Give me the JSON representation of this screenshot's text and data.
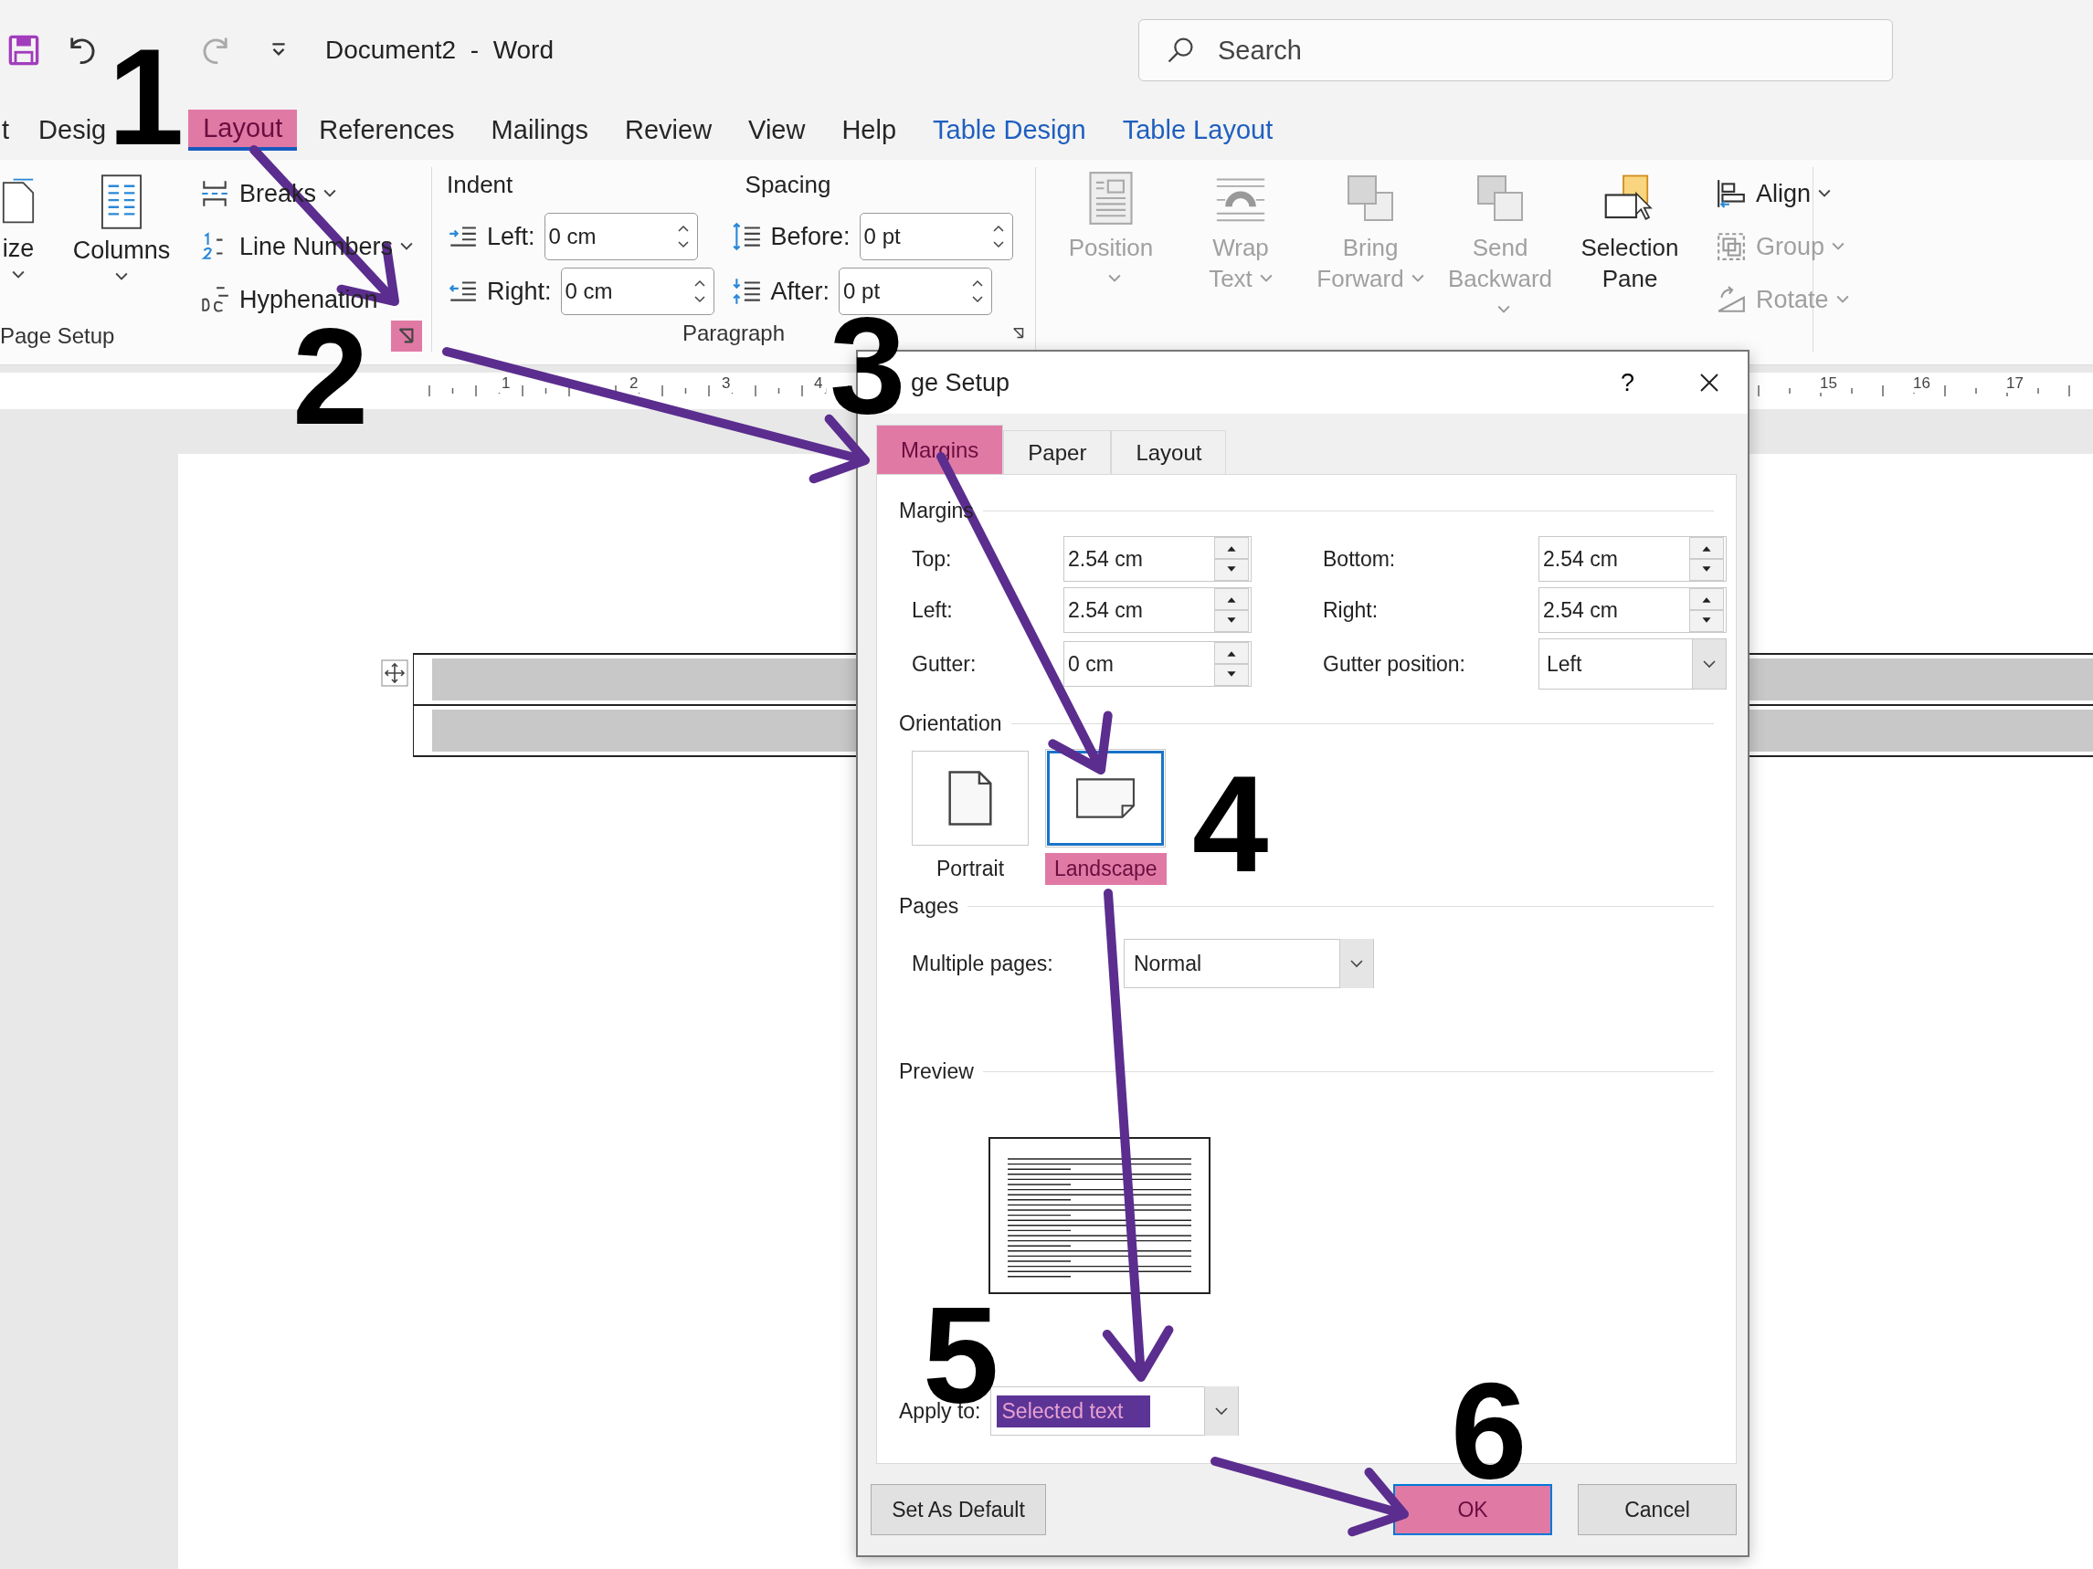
{
  "title_bar": {
    "title": "Document2  -  Word",
    "search": {
      "placeholder": "Search"
    }
  },
  "ribbon_tabs": [
    {
      "label": "t",
      "selected": false,
      "contextual": false,
      "highlighted": false
    },
    {
      "label": "Desig",
      "selected": false,
      "contextual": false,
      "highlighted": false
    },
    {
      "label": "Layout",
      "selected": true,
      "contextual": false,
      "highlighted": true
    },
    {
      "label": "References",
      "selected": false,
      "contextual": false,
      "highlighted": false
    },
    {
      "label": "Mailings",
      "selected": false,
      "contextual": false,
      "highlighted": false
    },
    {
      "label": "Review",
      "selected": false,
      "contextual": false,
      "highlighted": false
    },
    {
      "label": "View",
      "selected": false,
      "contextual": false,
      "highlighted": false
    },
    {
      "label": "Help",
      "selected": false,
      "contextual": false,
      "highlighted": false
    },
    {
      "label": "Table Design",
      "selected": false,
      "contextual": true,
      "highlighted": false
    },
    {
      "label": "Table Layout",
      "selected": false,
      "contextual": true,
      "highlighted": false
    }
  ],
  "ribbon": {
    "page_setup": {
      "size_label": "ize",
      "columns_label": "Columns",
      "commands": [
        {
          "label": "Breaks",
          "kind": "breaks"
        },
        {
          "label": "Line Numbers",
          "kind": "line-numbers"
        },
        {
          "label": "Hyphenation",
          "kind": "hyphenation"
        }
      ],
      "group_label": "Page Setup",
      "launcher_highlighted": true
    },
    "paragraph": {
      "indent_label": "Indent",
      "spacing_label": "Spacing",
      "indent": [
        {
          "label": "Left:",
          "value": "0 cm",
          "kind": "indent-left"
        },
        {
          "label": "Right:",
          "value": "0 cm",
          "kind": "indent-right"
        }
      ],
      "spacing": [
        {
          "label": "Before:",
          "value": "0 pt",
          "kind": "before"
        },
        {
          "label": "After:",
          "value": "0 pt",
          "kind": "after"
        }
      ],
      "group_label": "Paragraph"
    },
    "arrange": {
      "buttons": [
        {
          "lines": [
            "Position"
          ],
          "kind": "position",
          "disabled": true
        },
        {
          "lines": [
            "Wrap",
            "Text"
          ],
          "kind": "wrap",
          "disabled": true
        },
        {
          "lines": [
            "Bring",
            "Forward"
          ],
          "kind": "bring",
          "disabled": true
        },
        {
          "lines": [
            "Send",
            "Backward"
          ],
          "kind": "send",
          "disabled": true
        },
        {
          "lines": [
            "Selection",
            "Pane"
          ],
          "kind": "selection",
          "disabled": false
        }
      ],
      "small": [
        {
          "label": "Align",
          "kind": "align",
          "disabled": false
        },
        {
          "label": "Group",
          "kind": "group",
          "disabled": true
        },
        {
          "label": "Rotate",
          "kind": "rotate",
          "disabled": true
        }
      ]
    }
  },
  "ruler": {
    "left_numbers": [
      "1",
      "2",
      "3",
      "4"
    ],
    "right_numbers": [
      "15",
      "16",
      "17"
    ]
  },
  "dialog": {
    "title": "ge Setup",
    "help": "?",
    "tabs": [
      {
        "label": "Margins",
        "selected": true,
        "highlighted": true
      },
      {
        "label": "Paper",
        "selected": false,
        "highlighted": false
      },
      {
        "label": "Layout",
        "selected": false,
        "highlighted": false
      }
    ],
    "margins_header": "Margins",
    "margin_fields": [
      {
        "label": "Top:",
        "value": "2.54 cm",
        "kind": "spin"
      },
      {
        "label": "Bottom:",
        "value": "2.54 cm",
        "kind": "spin"
      },
      {
        "label": "Left:",
        "value": "2.54 cm",
        "kind": "spin"
      },
      {
        "label": "Right:",
        "value": "2.54 cm",
        "kind": "spin"
      },
      {
        "label": "Gutter:",
        "value": "0 cm",
        "kind": "spin"
      },
      {
        "label": "Gutter position:",
        "value": "Left",
        "kind": "select"
      }
    ],
    "orientation_header": "Orientation",
    "orientations": [
      {
        "label": "Portrait",
        "kind": "portrait",
        "selected": false,
        "highlighted": false
      },
      {
        "label": "Landscape",
        "kind": "landscape",
        "selected": true,
        "highlighted": true
      }
    ],
    "pages_header": "Pages",
    "multiple_pages": {
      "label": "Multiple pages:",
      "value": "Normal"
    },
    "preview_header": "Preview",
    "apply_to": {
      "label": "Apply to:",
      "value": "Selected text",
      "highlighted": true
    },
    "buttons": [
      {
        "label": "Set As Default",
        "kind": "secondary",
        "highlighted": false
      },
      {
        "label": "OK",
        "kind": "default",
        "highlighted": true
      },
      {
        "label": "Cancel",
        "kind": "secondary",
        "highlighted": false
      }
    ]
  },
  "steps": [
    "1",
    "2",
    "3",
    "4",
    "5",
    "6"
  ]
}
